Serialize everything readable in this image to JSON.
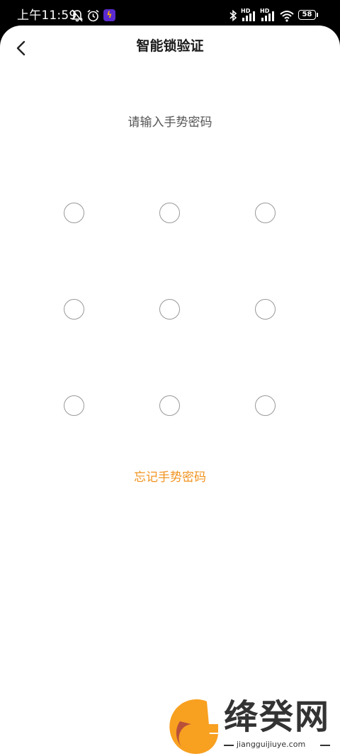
{
  "status_bar": {
    "time": "上午11:59",
    "battery": "58",
    "hd1": "HD",
    "hd2": "HD",
    "icons": [
      "mute-bell-icon",
      "alarm-icon",
      "app-icon",
      "bluetooth-icon",
      "signal-icon",
      "signal-icon",
      "wifi-icon",
      "battery-icon"
    ]
  },
  "header": {
    "title": "智能锁验证",
    "back_icon": "chevron-left-icon"
  },
  "main": {
    "prompt": "请输入手势密码",
    "gesture_dots": 9,
    "forgot_label": "忘记手势密码"
  },
  "watermark": {
    "brand": "绛癸网",
    "url": "jiangguijiuye.com"
  },
  "colors": {
    "accent": "#f0931f",
    "dot_border": "#999999",
    "prompt_text": "#555555",
    "title_text": "#1a1a1a",
    "logo_orange": "#f8a020",
    "logo_red": "#b8503a"
  }
}
